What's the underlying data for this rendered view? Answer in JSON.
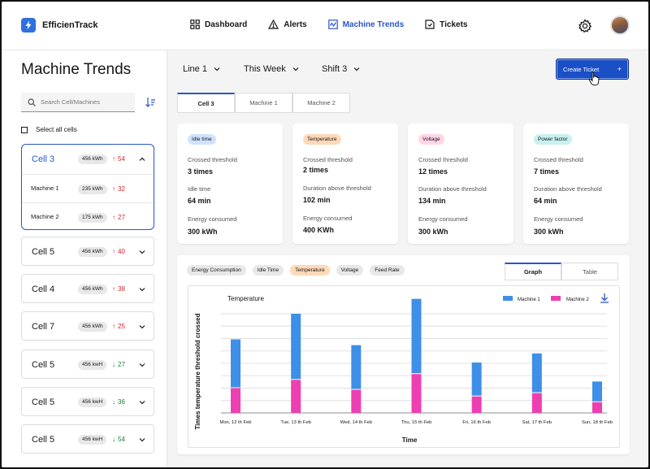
{
  "app": {
    "name": "EfficienTrack"
  },
  "nav": {
    "items": [
      {
        "label": "Dashboard",
        "icon": "grid-icon"
      },
      {
        "label": "Alerts",
        "icon": "warning-icon"
      },
      {
        "label": "Machine Trends",
        "icon": "trend-icon",
        "active": true
      },
      {
        "label": "Tickets",
        "icon": "ticket-icon"
      }
    ]
  },
  "sidebar": {
    "title": "Machine Trends",
    "search_placeholder": "Search Cell/Machines",
    "select_all": "Select all cells",
    "cells": [
      {
        "name": "Cell 3",
        "kwh": "456 kWh",
        "trend": "54",
        "dir": "up",
        "expanded": true,
        "machines": [
          {
            "name": "Machine 1",
            "kwh": "235 kWh",
            "trend": "32",
            "dir": "up"
          },
          {
            "name": "Machine 2",
            "kwh": "175 kWh",
            "trend": "27",
            "dir": "up"
          }
        ]
      },
      {
        "name": "Cell 5",
        "kwh": "456 kWh",
        "trend": "40",
        "dir": "up"
      },
      {
        "name": "Cell 4",
        "kwh": "456 kWh",
        "trend": "38",
        "dir": "up"
      },
      {
        "name": "Cell 7",
        "kwh": "456 kWh",
        "trend": "25",
        "dir": "up"
      },
      {
        "name": "Cell 5",
        "kwh": "456 kwH",
        "trend": "27",
        "dir": "down"
      },
      {
        "name": "Cell 5",
        "kwh": "456 kwH",
        "trend": "36",
        "dir": "down"
      },
      {
        "name": "Cell 5",
        "kwh": "456 kwH",
        "trend": "54",
        "dir": "down"
      }
    ]
  },
  "filters": {
    "line": "Line 1",
    "period": "This Week",
    "shift": "Shift 3"
  },
  "actions": {
    "create_ticket": "Create Ticket",
    "create_plus": "+"
  },
  "tabs": [
    "Cell 3",
    "Machine 1",
    "Machine 2"
  ],
  "metrics": [
    {
      "tag": "Idle time",
      "tag_color": "#d0e2ff",
      "l1": "Crossed threshold",
      "v1": "3 times",
      "l2": "Idle time",
      "v2": "64 min",
      "l3": "Energy consumed",
      "v3": "300 kWh"
    },
    {
      "tag": "Temperature",
      "tag_color": "#ffd9b8",
      "l1": "Crossed threshold",
      "v1": "2 times",
      "l2": "Duration above threshold",
      "v2": "102 min",
      "l3": "Energy consumed",
      "v3": "400 KWh"
    },
    {
      "tag": "Voltage",
      "tag_color": "#ffd6e8",
      "l1": "Crossed threshold",
      "v1": "12 times",
      "l2": "Duration above threshold",
      "v2": "134 min",
      "l3": "Energy consumed",
      "v3": "300 kWh"
    },
    {
      "tag": "Power factor",
      "tag_color": "#c8f0ee",
      "l1": "Crossed threshold",
      "v1": "7 times",
      "l2": "Duration above threshold",
      "v2": "64 min",
      "l3": "Energy consumed",
      "v3": "300 kWh"
    }
  ],
  "chart_pills": [
    {
      "label": "Energy Consumption"
    },
    {
      "label": "Idle Time"
    },
    {
      "label": "Temperature",
      "active": true
    },
    {
      "label": "Voltage"
    },
    {
      "label": "Feed Rate"
    }
  ],
  "view_tabs": [
    "Graph",
    "Table"
  ],
  "colors": {
    "machine1": "#3d8fe8",
    "machine2": "#ee3fb2",
    "accent": "#2a55c9"
  },
  "chart_data": {
    "type": "bar",
    "stacked": true,
    "title": "Temperature",
    "xlabel": "Time",
    "ylabel": "Times temperature threshold crossed",
    "categories": [
      "Mon, 12 th Feb",
      "Tue, 13 th Feb",
      "Wed, 14 th Feb",
      "Thu, 15 th Feb",
      "Fri, 16 th Feb",
      "Sat, 17 th Feb",
      "Sun, 18 th Feb"
    ],
    "series": [
      {
        "name": "Machine 1",
        "values": [
          5.9,
          8.0,
          5.4,
          9.1,
          4.1,
          4.8,
          2.5
        ]
      },
      {
        "name": "Machine 2",
        "values": [
          3.0,
          4.0,
          2.8,
          4.7,
          2.0,
          2.4,
          1.3
        ]
      }
    ],
    "ylim": [
      0,
      12
    ],
    "grid": true,
    "legend": "top-right",
    "axis_tick_labels_shown": false
  }
}
